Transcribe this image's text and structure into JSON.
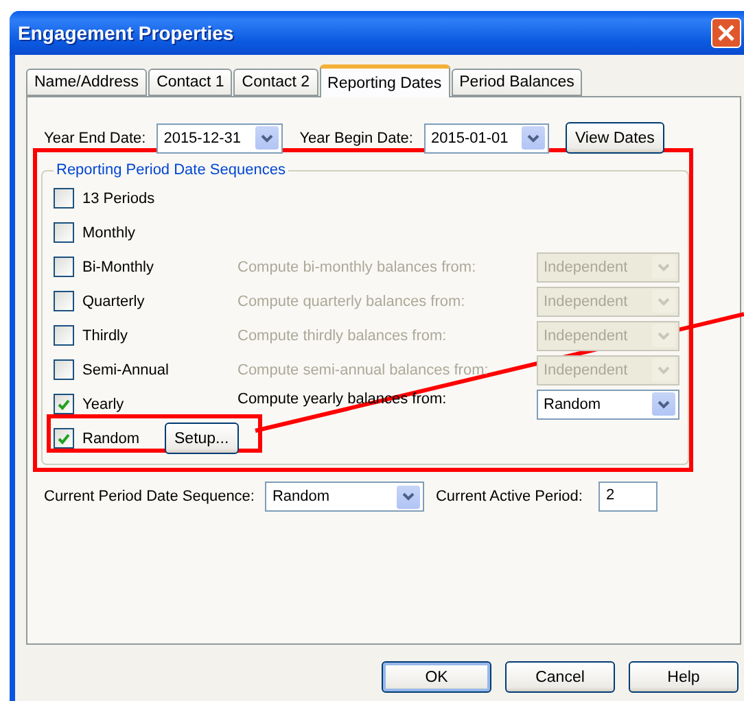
{
  "window": {
    "title": "Engagement Properties"
  },
  "tabs": [
    {
      "label": "Name/Address",
      "selected": false
    },
    {
      "label": "Contact 1",
      "selected": false
    },
    {
      "label": "Contact 2",
      "selected": false
    },
    {
      "label": "Reporting Dates",
      "selected": true
    },
    {
      "label": "Period Balances",
      "selected": false
    }
  ],
  "dates": {
    "year_end_label": "Year End Date:",
    "year_end_value": "2015-12-31",
    "year_begin_label": "Year Begin Date:",
    "year_begin_value": "2015-01-01",
    "view_button": "View Dates"
  },
  "group": {
    "title": "Reporting Period Date Sequences",
    "rows": [
      {
        "kind": "plain",
        "label": "13 Periods",
        "checked": false
      },
      {
        "kind": "plain",
        "label": "Monthly",
        "checked": false
      },
      {
        "kind": "compute",
        "label": "Bi-Monthly",
        "checked": false,
        "compute_label": "Compute bi-monthly balances from:",
        "compute_value": "Independent",
        "disabled": true
      },
      {
        "kind": "compute",
        "label": "Quarterly",
        "checked": false,
        "compute_label": "Compute quarterly balances from:",
        "compute_value": "Independent",
        "disabled": true
      },
      {
        "kind": "compute",
        "label": "Thirdly",
        "checked": false,
        "compute_label": "Compute thirdly balances from:",
        "compute_value": "Independent",
        "disabled": true
      },
      {
        "kind": "compute",
        "label": "Semi-Annual",
        "checked": false,
        "compute_label": "Compute semi-annual balances from:",
        "compute_value": "Independent",
        "disabled": true
      },
      {
        "kind": "compute",
        "label": "Yearly",
        "checked": true,
        "compute_label": "Compute yearly balances from:",
        "compute_value": "Random",
        "disabled": false
      },
      {
        "kind": "setup",
        "label": "Random",
        "checked": true,
        "button": "Setup..."
      }
    ]
  },
  "current": {
    "sequence_label": "Current Period Date Sequence:",
    "sequence_value": "Random",
    "period_label": "Current Active Period:",
    "period_value": "2"
  },
  "buttons": [
    {
      "label": "OK",
      "default": true
    },
    {
      "label": "Cancel",
      "default": false
    },
    {
      "label": "Help",
      "default": false
    }
  ]
}
